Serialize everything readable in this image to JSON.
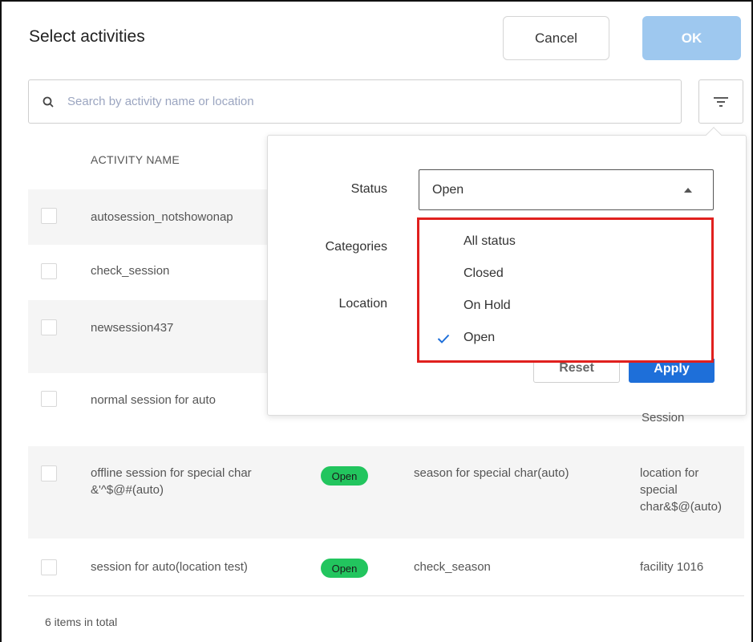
{
  "dialog": {
    "title": "Select activities",
    "cancel_label": "Cancel",
    "ok_label": "OK"
  },
  "search": {
    "placeholder": "Search by activity name or location",
    "value": ""
  },
  "table": {
    "column_activity_name": "ACTIVITY NAME",
    "rows": [
      {
        "name": "autosession_notshowonap",
        "status": "",
        "season": "",
        "location": ""
      },
      {
        "name": "check_session",
        "status": "",
        "season": "",
        "location": ""
      },
      {
        "name": "newsession437",
        "status": "",
        "season": "",
        "location": ""
      },
      {
        "name": "normal session for auto",
        "status": "",
        "season": "",
        "location": "Session"
      },
      {
        "name_line1": "offline session for special char",
        "name_line2": "&'^$@#(auto)",
        "status": "Open",
        "season": "season for special char(auto)",
        "location_line1": "location for",
        "location_line2": "special",
        "location_line3": "char&$@(auto)"
      },
      {
        "name": "session for auto(location test)",
        "status": "Open",
        "season": "check_season",
        "location": "facility 1016"
      }
    ],
    "total_text": "6 items in total"
  },
  "filter": {
    "status_label": "Status",
    "categories_label": "Categories",
    "location_label": "Location",
    "status_value": "Open",
    "status_options": [
      "All status",
      "Closed",
      "On Hold",
      "Open"
    ],
    "selected_option": "Open",
    "reset_label": "Reset",
    "apply_label": "Apply"
  },
  "colors": {
    "primary": "#1e6fd9",
    "ok_disabled": "#9ec8ef",
    "badge_open": "#22c55e",
    "highlight_border": "#e0201e"
  },
  "icons": {
    "search": "search-icon",
    "filter": "filter-icon",
    "check": "check-icon",
    "caret": "caret-up-icon"
  }
}
